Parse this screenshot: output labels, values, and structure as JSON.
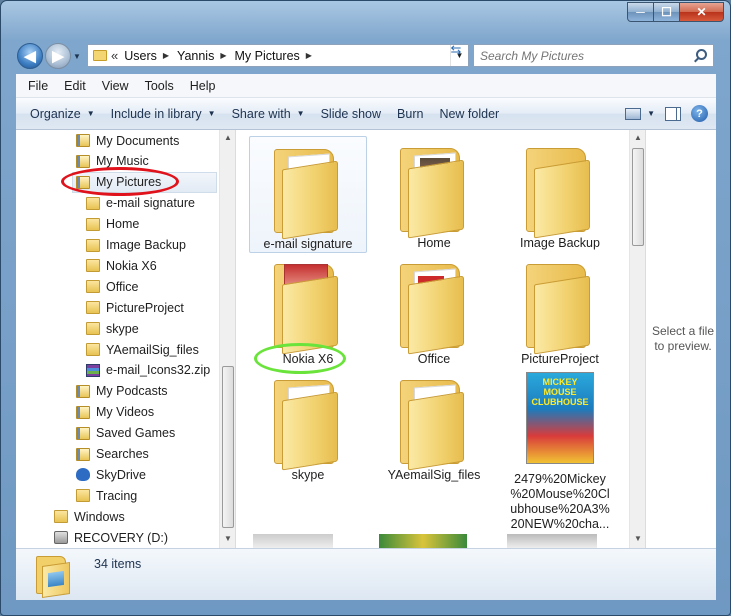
{
  "window": {
    "minimize_label": "─",
    "maximize_label": "☐",
    "close_label": "✕"
  },
  "address": {
    "crumbs": [
      "Users",
      "Yannis",
      "My Pictures"
    ],
    "overflow": "«"
  },
  "search": {
    "placeholder": "Search My Pictures"
  },
  "menu": [
    "File",
    "Edit",
    "View",
    "Tools",
    "Help"
  ],
  "commands": [
    {
      "label": "Organize",
      "dropdown": true
    },
    {
      "label": "Include in library",
      "dropdown": true
    },
    {
      "label": "Share with",
      "dropdown": true
    },
    {
      "label": "Slide show",
      "dropdown": false
    },
    {
      "label": "Burn",
      "dropdown": false
    },
    {
      "label": "New folder",
      "dropdown": false
    }
  ],
  "help_label": "?",
  "nav": [
    {
      "label": "My Documents",
      "icon": "library-folder-icon",
      "level": 1
    },
    {
      "label": "My Music",
      "icon": "library-folder-icon",
      "level": 1
    },
    {
      "label": "My Pictures",
      "icon": "library-folder-icon",
      "level": 1,
      "selected": true
    },
    {
      "label": "e-mail signature",
      "icon": "folder-icon",
      "level": 2
    },
    {
      "label": "Home",
      "icon": "folder-icon",
      "level": 2
    },
    {
      "label": "Image Backup",
      "icon": "folder-icon",
      "level": 2
    },
    {
      "label": "Nokia X6",
      "icon": "folder-icon",
      "level": 2
    },
    {
      "label": "Office",
      "icon": "folder-icon",
      "level": 2
    },
    {
      "label": "PictureProject",
      "icon": "folder-icon",
      "level": 2
    },
    {
      "label": "skype",
      "icon": "folder-icon",
      "level": 2
    },
    {
      "label": "YAemailSig_files",
      "icon": "folder-icon",
      "level": 2
    },
    {
      "label": "e-mail_Icons32.zip",
      "icon": "zip-archive-icon",
      "level": 2
    },
    {
      "label": "My Podcasts",
      "icon": "library-folder-icon",
      "level": 1
    },
    {
      "label": "My Videos",
      "icon": "library-folder-icon",
      "level": 1
    },
    {
      "label": "Saved Games",
      "icon": "library-folder-icon",
      "level": 1
    },
    {
      "label": "Searches",
      "icon": "library-folder-icon",
      "level": 1
    },
    {
      "label": "SkyDrive",
      "icon": "cloud-icon",
      "level": 1
    },
    {
      "label": "Tracing",
      "icon": "folder-icon",
      "level": 1
    },
    {
      "label": "Windows",
      "icon": "folder-icon",
      "level": 0
    },
    {
      "label": "RECOVERY (D:)",
      "icon": "drive-icon",
      "level": 0
    }
  ],
  "files": [
    {
      "label": "e-mail signature",
      "kind": "folder",
      "content": "paper"
    },
    {
      "label": "Home",
      "kind": "folder",
      "content": "photo"
    },
    {
      "label": "Image Backup",
      "kind": "folder",
      "content": "empty"
    },
    {
      "label": "Nokia X6",
      "kind": "folder",
      "content": "magazine"
    },
    {
      "label": "Office",
      "kind": "folder",
      "content": "red"
    },
    {
      "label": "PictureProject",
      "kind": "folder",
      "content": "empty"
    },
    {
      "label": "skype",
      "kind": "folder",
      "content": "paper"
    },
    {
      "label": "YAemailSig_files",
      "kind": "folder",
      "content": "paper"
    },
    {
      "label": "2479%20Mickey %20Mouse%20Cl ubhouse%20A3% 20NEW%20cha...",
      "kind": "image",
      "cover_text": "MICKEY MOUSE CLUBHOUSE"
    }
  ],
  "preview": {
    "text": "Select a file to preview."
  },
  "status": {
    "count": "34 items"
  },
  "colors": {
    "selection_ring": "#e0121b",
    "highlight_ring": "#6ae33b",
    "window_frame": "#7fa6cc"
  }
}
